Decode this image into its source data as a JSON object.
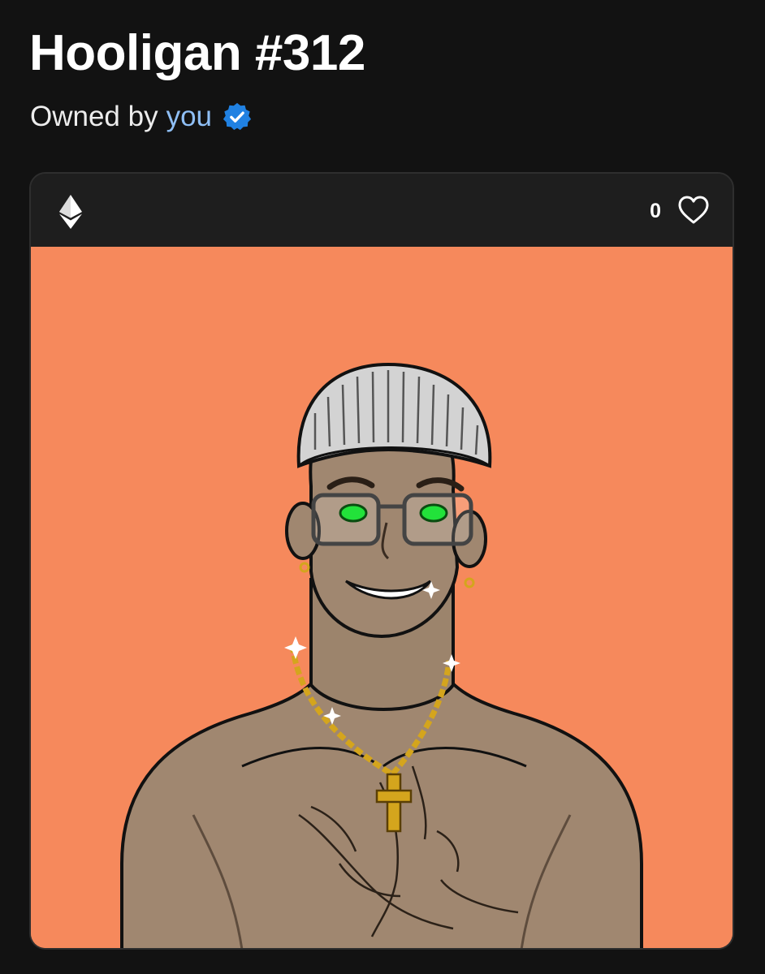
{
  "item": {
    "title": "Hooligan #312",
    "owned_by_prefix": "Owned by",
    "owner": "you"
  },
  "card": {
    "chain_icon": "ethereum-icon",
    "favorites_count": "0",
    "favorite_icon": "heart-outline-icon",
    "verified_icon": "verified-badge-icon"
  },
  "artwork": {
    "background_color": "#f6895c",
    "subject": "cartoon-character-beanie-glasses-gold-cross-chain"
  },
  "colors": {
    "page_bg": "#121212",
    "card_bg": "#1e1e1e",
    "link": "#8fbff5",
    "verified": "#2081e2"
  }
}
